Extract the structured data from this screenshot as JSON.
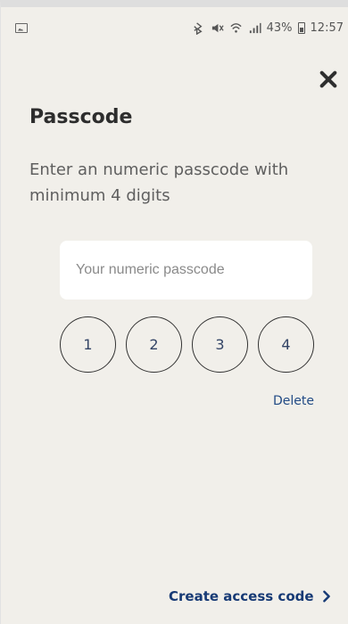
{
  "status_bar": {
    "battery_text": "43%",
    "time": "12:57"
  },
  "icons": {
    "left_status": "image-icon",
    "bluetooth": "bluetooth-icon",
    "mute": "mute-icon",
    "wifi": "wifi-icon",
    "signal": "signal-icon",
    "battery": "battery-icon",
    "close": "close-icon",
    "chevron": "chevron-right-icon"
  },
  "page": {
    "title": "Passcode",
    "instructions": "Enter an numeric passcode with minimum 4 digits"
  },
  "passcode": {
    "placeholder": "Your numeric passcode",
    "value": ""
  },
  "digits": [
    "1",
    "2",
    "3",
    "4"
  ],
  "actions": {
    "delete": "Delete",
    "create_access_code": "Create access code"
  },
  "colors": {
    "background": "#f1efea",
    "input_background": "#ffffff",
    "accent_blue": "#224b85",
    "dark_blue": "#173a75",
    "text_dark": "#2d2d2d",
    "text_muted": "#5f5f5f"
  }
}
